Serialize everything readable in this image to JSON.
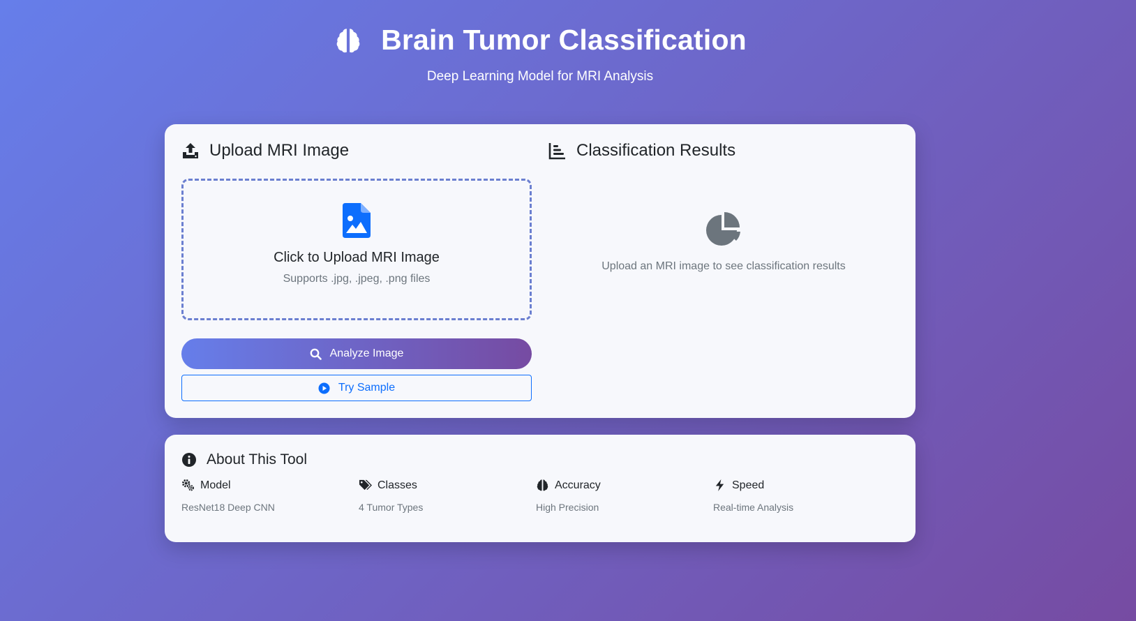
{
  "header": {
    "title": "Brain Tumor Classification",
    "subtitle": "Deep Learning Model for MRI Analysis",
    "icon": "brain-icon"
  },
  "upload": {
    "title": "Upload MRI Image",
    "icon": "upload-icon",
    "dropzone_title": "Click to Upload MRI Image",
    "dropzone_subtitle": "Supports .jpg, .jpeg, .png files",
    "dropzone_icon": "file-image-icon",
    "analyze_label": "Analyze Image",
    "analyze_icon": "search-icon",
    "sample_label": "Try Sample",
    "sample_icon": "play-circle-icon"
  },
  "results": {
    "title": "Classification Results",
    "icon": "bar-chart-icon",
    "empty_icon": "pie-chart-icon",
    "empty_text": "Upload an MRI image to see classification results"
  },
  "about": {
    "title": "About This Tool",
    "icon": "info-circle-icon",
    "features": [
      {
        "label": "Model",
        "value": "ResNet18 Deep CNN",
        "icon": "gears-icon"
      },
      {
        "label": "Classes",
        "value": "4 Tumor Types",
        "icon": "tags-icon"
      },
      {
        "label": "Accuracy",
        "value": "High Precision",
        "icon": "brain-icon"
      },
      {
        "label": "Speed",
        "value": "Real-time Analysis",
        "icon": "bolt-icon"
      }
    ]
  },
  "colors": {
    "gradient_start": "#667eea",
    "gradient_end": "#764ba2",
    "primary": "#0d6efd",
    "muted": "#6c757d",
    "dashed_border": "#6b7fd0"
  }
}
